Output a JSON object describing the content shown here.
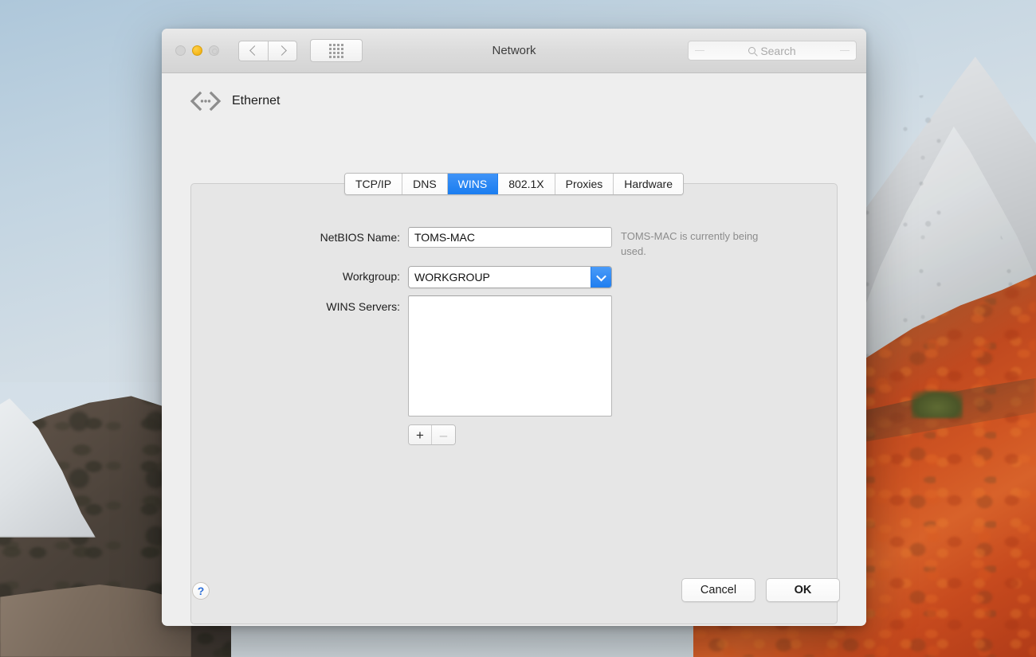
{
  "window": {
    "title": "Network",
    "traffic_lights": [
      {
        "name": "close",
        "state": "disabled",
        "color": "#d3d3d3"
      },
      {
        "name": "minimize",
        "state": "enabled",
        "color": "#f8bc22"
      },
      {
        "name": "zoom",
        "state": "disabled",
        "color": "#d3d3d3"
      }
    ],
    "nav": {
      "back": "‹",
      "forward": "›",
      "show_all": "show-all-grid"
    },
    "search": {
      "placeholder": "Search",
      "value": ""
    }
  },
  "interface": {
    "name": "Ethernet",
    "icon": "ethernet-icon"
  },
  "tabs": [
    {
      "label": "TCP/IP",
      "active": false
    },
    {
      "label": "DNS",
      "active": false
    },
    {
      "label": "WINS",
      "active": true
    },
    {
      "label": "802.1X",
      "active": false
    },
    {
      "label": "Proxies",
      "active": false
    },
    {
      "label": "Hardware",
      "active": false
    }
  ],
  "form": {
    "netbios_label": "NetBIOS Name:",
    "netbios_value": "TOMS-MAC",
    "netbios_hint": "TOMS-MAC is currently being used.",
    "workgroup_label": "Workgroup:",
    "workgroup_value": "WORKGROUP",
    "wins_label": "WINS Servers:",
    "wins_servers": [],
    "add_label": "+",
    "remove_label": "–"
  },
  "footer": {
    "help_label": "?",
    "cancel_label": "Cancel",
    "ok_label": "OK"
  },
  "colors": {
    "accent": "#1a7df0",
    "help_blue": "#2d6fd8",
    "hint_gray": "#8c8c8c"
  }
}
